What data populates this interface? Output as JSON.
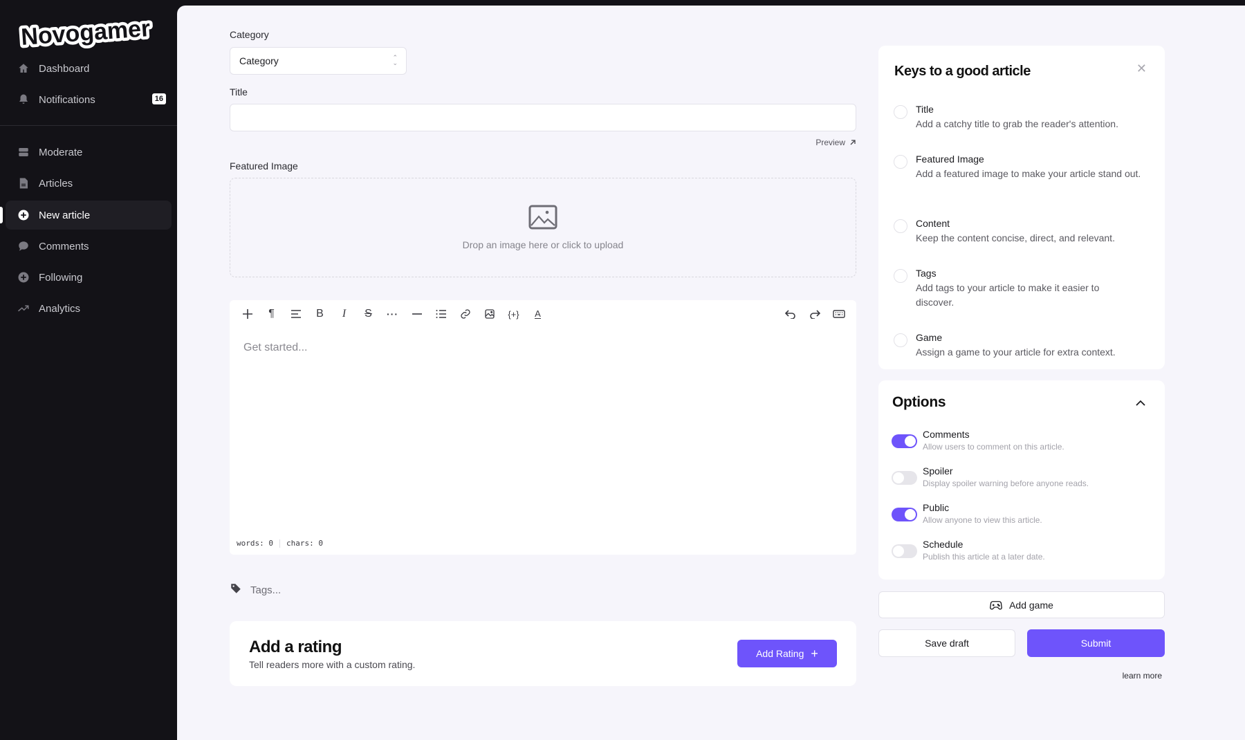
{
  "brand": {
    "name": "Novogamer"
  },
  "sidebar": {
    "items": [
      {
        "label": "Dashboard",
        "icon": "home-icon"
      },
      {
        "label": "Notifications",
        "icon": "bell-icon",
        "badge": "16"
      },
      {
        "label": "Moderate",
        "icon": "inbox-icon"
      },
      {
        "label": "Articles",
        "icon": "document-icon"
      },
      {
        "label": "New article",
        "icon": "plus-circle-icon",
        "active": true
      },
      {
        "label": "Comments",
        "icon": "chat-bubble-icon"
      },
      {
        "label": "Following",
        "icon": "plus-circle-icon"
      },
      {
        "label": "Analytics",
        "icon": "trending-up-icon"
      }
    ]
  },
  "form": {
    "category_label": "Category",
    "category_value": "Category",
    "title_label": "Title",
    "title_value": "",
    "preview_label": "Preview",
    "featured_image_label": "Featured Image",
    "dropzone_text": "Drop an image here or click to upload",
    "editor": {
      "placeholder": "Get started...",
      "toolbar": [
        "add",
        "paragraph",
        "align",
        "bold",
        "italic",
        "strikethrough",
        "more",
        "horizontal-rule",
        "bullet-list",
        "link",
        "image",
        "embed",
        "text-color"
      ],
      "toolbar_right": [
        "undo",
        "redo",
        "keyboard"
      ],
      "words": "words: 0",
      "chars": "chars: 0"
    },
    "tags_placeholder": "Tags...",
    "rating": {
      "title": "Add a rating",
      "subtitle": "Tell readers more with a custom rating.",
      "button_label": "Add Rating"
    }
  },
  "keys": {
    "title": "Keys to a good article",
    "items": [
      {
        "title": "Title",
        "desc": "Add a catchy title to grab the reader's attention."
      },
      {
        "title": "Featured Image",
        "desc": "Add a featured image to make your article stand out."
      },
      {
        "title": "Content",
        "desc": "Keep the content concise, direct, and relevant."
      },
      {
        "title": "Tags",
        "desc": "Add tags to your article to make it easier to discover."
      },
      {
        "title": "Game",
        "desc": "Assign a game to your article for extra context."
      }
    ]
  },
  "options": {
    "title": "Options",
    "items": [
      {
        "title": "Comments",
        "desc": "Allow users to comment on this article.",
        "on": true
      },
      {
        "title": "Spoiler",
        "desc": "Display spoiler warning before anyone reads.",
        "on": false
      },
      {
        "title": "Public",
        "desc": "Allow anyone to view this article.",
        "on": true
      },
      {
        "title": "Schedule",
        "desc": "Publish this article at a later date.",
        "on": false
      }
    ]
  },
  "actions": {
    "add_game": "Add game",
    "save_draft": "Save draft",
    "submit": "Submit",
    "learn_more": "learn more"
  },
  "colors": {
    "accent": "#6e54fb",
    "sidebar_bg": "#131217",
    "page_bg": "#f6f5fb"
  }
}
